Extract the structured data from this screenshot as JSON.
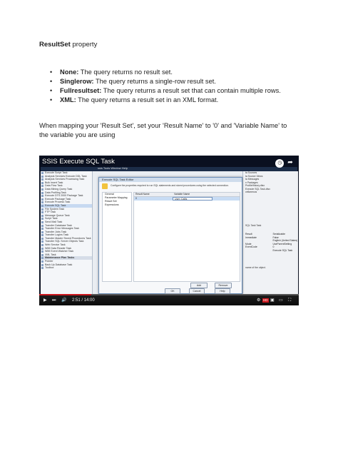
{
  "heading": {
    "bold": "ResultSet",
    "rest": " property"
  },
  "bullets": [
    {
      "term": "None:",
      "desc": " The query returns no result set."
    },
    {
      "term": "Singlerow:",
      "desc": " The query returns a single-row result set."
    },
    {
      "term": "Fullresultset:",
      "desc": " The query returns a result set that can contain multiple rows."
    },
    {
      "term": "XML:",
      "desc": " The query returns a result set in an XML format."
    }
  ],
  "paragraph": "When mapping your 'Result Set', set your 'Result Name' to '0' and 'Variable Name' to the variable you are using",
  "video": {
    "title": "SSIS Execute SQL Task",
    "app_menu": "ssis   Tools   Window   Help",
    "toolbox_items": [
      "Execute Script Task",
      "Analysis Services Execute DDL Task",
      "Analysis Services Processing Task",
      "Bulk Insert Task",
      "Data Flow Task",
      "Data Mining Query Task",
      "Data Profiling Task",
      "Execute DTS 2000 Package Task",
      "Execute Package Task",
      "Execute Process Task",
      "Execute SQL Task",
      "File System Task",
      "FTP Task",
      "Message Queue Task",
      "Script Task",
      "Send Mail Task",
      "Transfer Database Task",
      "Transfer Error Messages Task",
      "Transfer Jobs Task",
      "Transfer Logins Task",
      "Transfer Master Stored Procedures Task",
      "Transfer SQL Server Objects Task",
      "Web Service Task",
      "WMI Data Reader Task",
      "WMI Event Watcher Task",
      "XML Task",
      "Maintenance Plan Tasks",
      "Pointer",
      "Back Up Database Task",
      "Toolbox"
    ],
    "right_panel_top": [
      "ta Sources",
      "ta Source Views",
      "ta Messages",
      "n Packages",
      "ProfileHistory.dtsx",
      "Execute SQL Task.dtsx",
      "cellaneous"
    ],
    "right_panel_tab": "SQL Task  Task",
    "right_panel_props": [
      [
        "Result",
        "Serializable"
      ],
      [
        "Immediate",
        "False"
      ],
      [
        "",
        "English (United States)"
      ],
      [
        "Mode",
        "UseParentSetting"
      ],
      [
        "EventCode",
        "0"
      ],
      [
        "",
        "Execute SQL Task"
      ]
    ],
    "right_panel_bottom": "name of the object.",
    "dialog": {
      "title": "Execute SQL Task Editor",
      "description": "Configure the properties required to run SQL statements and stored procedures using the selected connection.",
      "nav": [
        "General",
        "Parameter Mapping",
        "Result Set",
        "Expressions"
      ],
      "grid_headers": [
        "Result Name",
        "Variable Name"
      ],
      "grid_row": [
        "0",
        "User::Callis"
      ],
      "buttons": {
        "add": "Add",
        "remove": "Remove",
        "ok": "OK",
        "cancel": "Cancel",
        "help": "Help"
      }
    },
    "player": {
      "time": "2:51 / 14:00",
      "progress_fraction": 0.2,
      "hd": "HD"
    }
  }
}
